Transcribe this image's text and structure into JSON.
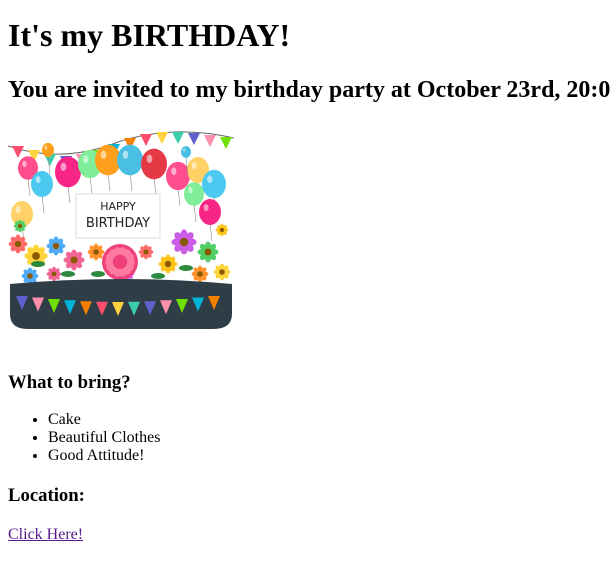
{
  "header": {
    "title": "It's my BIRTHDAY!",
    "subtitle": "You are invited to my birthday party at October 23rd, 20:0"
  },
  "image": {
    "banner_text_line1": "HAPPY",
    "banner_text_line2": "BIRTHDAY",
    "colors": {
      "pennant": [
        "#ff4d6d",
        "#ffd23f",
        "#3bceac",
        "#5e60ce",
        "#ff8fab",
        "#70e000",
        "#00b4d8",
        "#f77f00"
      ],
      "balloons": [
        "#ff4d8d",
        "#ffd166",
        "#4cc9f0",
        "#f72585",
        "#80ed99",
        "#ff9f1c",
        "#48bfe3",
        "#e63946"
      ],
      "base": "#2f3e46"
    }
  },
  "bring": {
    "heading": "What to bring?",
    "items": [
      "Cake",
      "Beautiful Clothes",
      "Good Attitude!"
    ]
  },
  "location": {
    "heading": "Location:",
    "link_text": "Click Here!"
  }
}
